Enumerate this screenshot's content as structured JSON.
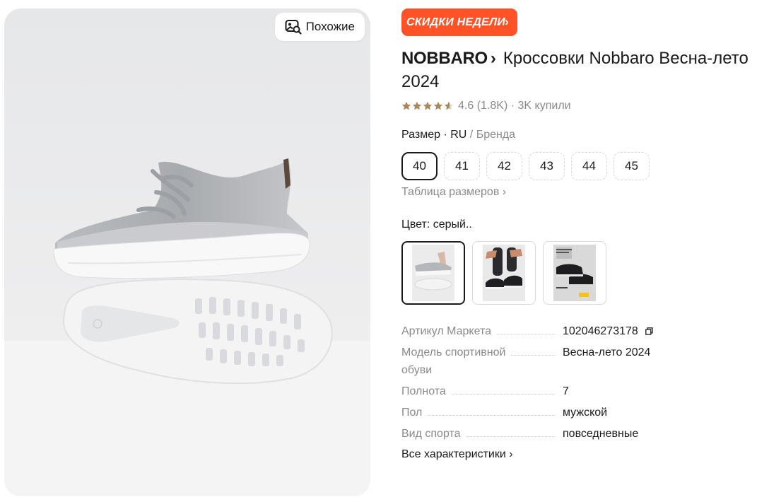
{
  "image": {
    "similar_button_label": "Похожие"
  },
  "promo": {
    "label": "СКИДКИ НЕДЕЛИ",
    "chevron": "›",
    "color": "#ff5226"
  },
  "product": {
    "brand": "NOBBARO",
    "brand_chevron": "›",
    "title": "Кроссовки Nobbaro Весна-лето 2024"
  },
  "rating": {
    "score": "4.6",
    "count": "(1.8K)",
    "separator": "·",
    "bought": "3K купили",
    "stars_value": 4.6,
    "star_color": "#a8875a"
  },
  "size": {
    "label": "Размер",
    "dot": "·",
    "system_selected": "RU",
    "slash": "/",
    "system_other": "Бренда",
    "options": [
      "40",
      "41",
      "42",
      "43",
      "44",
      "45"
    ],
    "selected": "40",
    "table_link": "Таблица размеров ›"
  },
  "color": {
    "label": "Цвет: серый..",
    "swatches": [
      {
        "icon": "grey-sneakers-thumbnail",
        "selected": true
      },
      {
        "icon": "black-sneakers-on-feet-thumbnail",
        "selected": false
      },
      {
        "icon": "black-sneakers-box-thumbnail",
        "selected": false
      }
    ]
  },
  "specs": [
    {
      "key_lines": [
        "Артикул Маркета"
      ],
      "value": "102046273178",
      "copy_icon": "copy-icon"
    },
    {
      "key_lines": [
        "Модель спортивной",
        "обуви"
      ],
      "value": "Весна-лето 2024"
    },
    {
      "key_lines": [
        "Полнота"
      ],
      "value": "7"
    },
    {
      "key_lines": [
        "Пол"
      ],
      "value": "мужской"
    },
    {
      "key_lines": [
        "Вид спорта"
      ],
      "value": "повседневные"
    }
  ],
  "all_specs_link": "Все характеристики ›"
}
